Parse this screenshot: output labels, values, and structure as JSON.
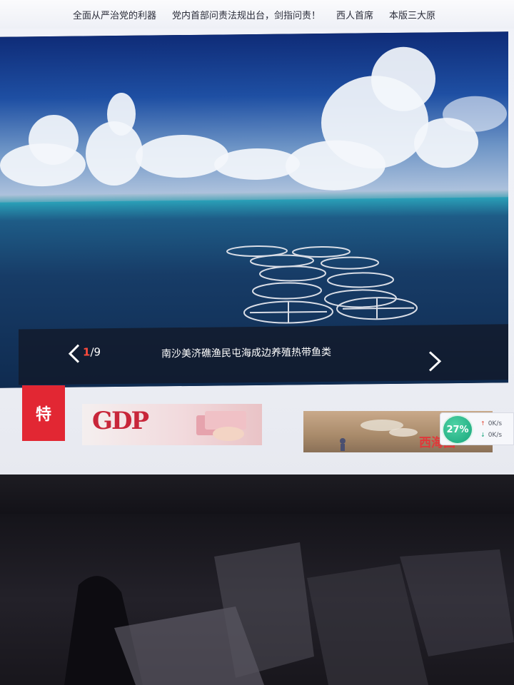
{
  "top_links": [
    "全面从严治党的利器",
    "党内首部问责法规出台，剑指问责！",
    "西人首席",
    "本版三大原"
  ],
  "slideshow": {
    "current_index": "1",
    "separator": "/",
    "total": "9",
    "caption": "南沙美济礁渔民屯海成边养殖热带鱼类",
    "prev_icon": "chevron-left-icon",
    "next_icon": "chevron-right-icon"
  },
  "feature": {
    "tag_label": "特",
    "thumb1_text": "GDP",
    "thumb2_title": "西海固"
  },
  "network_widget": {
    "percent": "27%",
    "upload": "0K/s",
    "download": "0K/s"
  },
  "colors": {
    "tag_red": "#e22733",
    "counter_red": "#ff4b3c",
    "widget_green": "#17a57b"
  }
}
